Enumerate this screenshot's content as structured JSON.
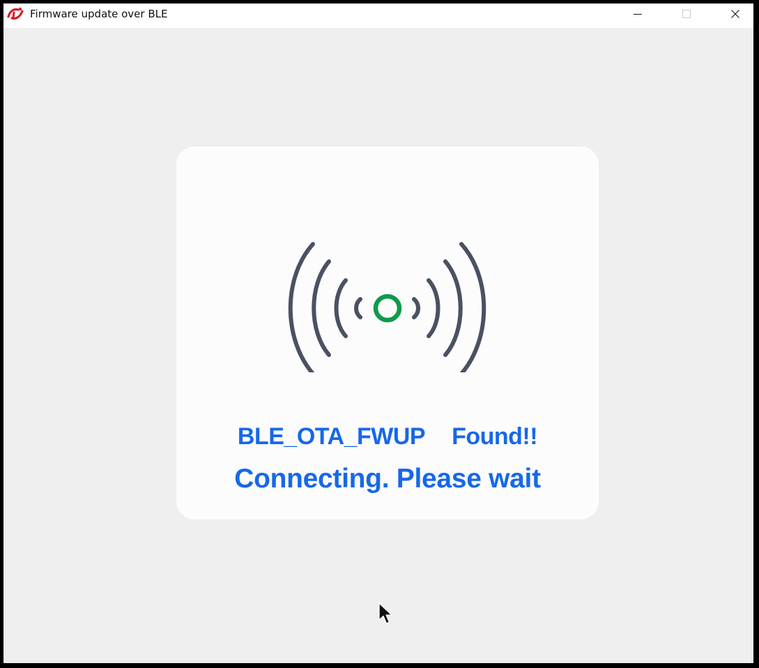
{
  "window": {
    "title": "Firmware update over BLE",
    "app_icon": "silicon-labs-logo-icon",
    "controls": [
      "minimize-icon",
      "maximize-icon",
      "close-icon"
    ]
  },
  "dialog": {
    "icon": "bluetooth-signal-icon",
    "device_name": "BLE_OTA_FWUP",
    "found_text": "Found!!",
    "status_text": "Connecting. Please wait"
  },
  "colors": {
    "accent_text": "#1768e8",
    "signal_arcs": "#4a5261",
    "signal_center": "#0f9a4a"
  }
}
